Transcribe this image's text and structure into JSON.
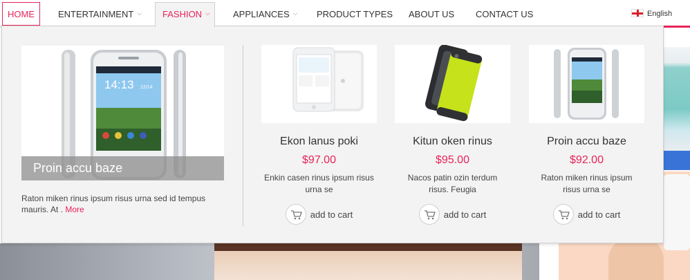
{
  "nav": {
    "items": [
      {
        "label": "HOME",
        "has_menu": false
      },
      {
        "label": "ENTERTAINMENT",
        "has_menu": true
      },
      {
        "label": "FASHION",
        "has_menu": true
      },
      {
        "label": "APPLIANCES",
        "has_menu": true
      },
      {
        "label": "PRODUCT TYPES",
        "has_menu": false
      },
      {
        "label": "ABOUT US",
        "has_menu": false
      },
      {
        "label": "CONTACT US",
        "has_menu": false
      }
    ],
    "active": "HOME",
    "open_menu": "FASHION",
    "language": "English",
    "language_icon": "england-flag-icon"
  },
  "featured": {
    "title": "Proin accu baze",
    "description": "Raton miken rinus ipsum risus urna sed id tempus mauris. At .",
    "more_label": "More",
    "phone_time": "14:13",
    "phone_date": "12/14"
  },
  "products": [
    {
      "name": "Ekon lanus poki",
      "price": "$97.00",
      "description": "Enkin casen rinus ipsum risus urna se",
      "cart_label": "add to cart",
      "image": "white-tablet-image"
    },
    {
      "name": "Kitun oken rinus",
      "price": "$95.00",
      "description": "Nacos patin ozin terdum risus. Feugia",
      "cart_label": "add to cart",
      "image": "lime-phone-case-image"
    },
    {
      "name": "Proin accu baze",
      "price": "$92.00",
      "description": "Raton miken rinus ipsum risus urna se",
      "cart_label": "add to cart",
      "image": "silver-smartphone-image"
    }
  ],
  "colors": {
    "accent": "#e8235a",
    "text": "#333333",
    "menu_bg": "#f3f3f3"
  },
  "icons": {
    "cart": "shopping-cart-icon",
    "submenu": "chevron-down-icon"
  }
}
